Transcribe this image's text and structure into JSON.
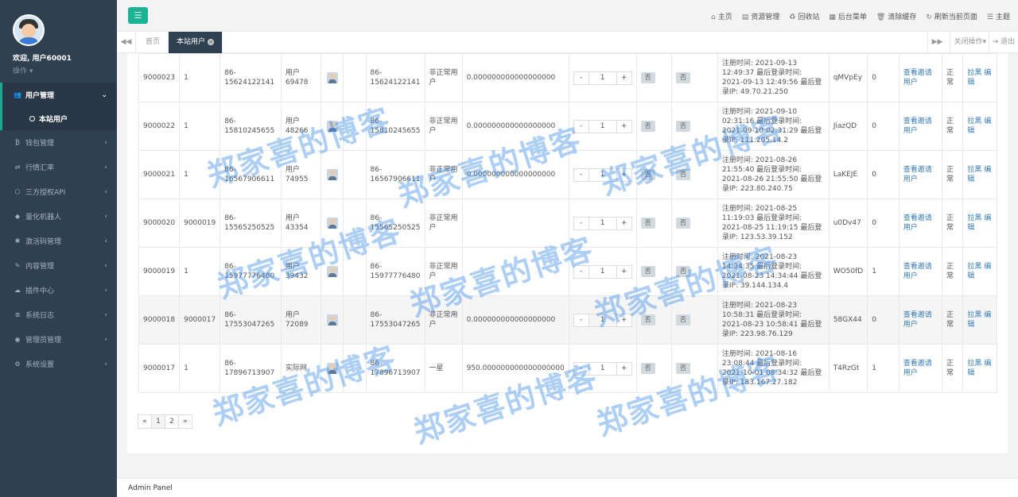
{
  "sidebar": {
    "welcome": "欢迎, 用户60001",
    "ops": "操作",
    "menu": [
      {
        "label": "用户管理",
        "icon": "users-icon",
        "glyph": "👥",
        "active": true
      },
      {
        "label": "钱包管理",
        "icon": "bitcoin-icon",
        "glyph": "₿"
      },
      {
        "label": "行情汇率",
        "icon": "exchange-icon",
        "glyph": "⇄"
      },
      {
        "label": "三方授权API",
        "icon": "cube-icon",
        "glyph": "⬡"
      },
      {
        "label": "量化机器人",
        "icon": "robot-icon",
        "glyph": "◆"
      },
      {
        "label": "激活码管理",
        "icon": "gear-icon",
        "glyph": "✱"
      },
      {
        "label": "内容管理",
        "icon": "edit-icon",
        "glyph": "✎"
      },
      {
        "label": "插件中心",
        "icon": "cloud-icon",
        "glyph": "☁"
      },
      {
        "label": "系统日志",
        "icon": "database-icon",
        "glyph": "≣"
      },
      {
        "label": "管理员管理",
        "icon": "user-circle-icon",
        "glyph": "◉"
      },
      {
        "label": "系统设置",
        "icon": "cogs-icon",
        "glyph": "⚙"
      }
    ],
    "submenu_active": "本站用户"
  },
  "topbar": {
    "links": [
      {
        "label": "主页",
        "glyph": "⌂"
      },
      {
        "label": "资源管理",
        "glyph": "▤"
      },
      {
        "label": "回收站",
        "glyph": "♻"
      },
      {
        "label": "后台菜单",
        "glyph": "▦"
      },
      {
        "label": "清除缓存",
        "glyph": "🗑"
      },
      {
        "label": "刷新当前页面",
        "glyph": "↻"
      },
      {
        "label": "主题",
        "glyph": "☰"
      }
    ]
  },
  "tabs": {
    "home": "首页",
    "current": "本站用户",
    "close_ops": "关闭操作",
    "logout": "退出"
  },
  "table": {
    "rows": [
      {
        "id": "9000023",
        "parent": "1",
        "phone": "86-15624122141",
        "name": "用户69478",
        "phone2": "86-15624122141",
        "type": "非正常用户",
        "balance": "0.000000000000000000",
        "qty": "1",
        "f1": "否",
        "f2": "否",
        "reg": "注册时间: 2021-09-13 12:49:37 最后登录时间: 2021-09-13 12:49:56 最后登录IP: 49.70.21.250",
        "code": "qMVpEy",
        "count": "0",
        "invite": "查看邀请用户",
        "status": "正常",
        "actions": "拉黑 编辑"
      },
      {
        "id": "9000022",
        "parent": "1",
        "phone": "86-15810245655",
        "name": "用户48266",
        "phone2": "86-15810245655",
        "type": "非正常用户",
        "balance": "0.000000000000000000",
        "qty": "1",
        "f1": "否",
        "f2": "否",
        "reg": "注册时间: 2021-09-10 02:31:16 最后登录时间: 2021-09-10 02:31:29 最后登录IP: 111.205.14.2",
        "code": "JiazQD",
        "count": "0",
        "invite": "查看邀请用户",
        "status": "正常",
        "actions": "拉黑 编辑"
      },
      {
        "id": "9000021",
        "parent": "1",
        "phone": "86-16567906611",
        "name": "用户74955",
        "phone2": "86-16567906611",
        "type": "非正常用户",
        "balance": "0.000000000000000000",
        "qty": "1",
        "f1": "否",
        "f2": "否",
        "reg": "注册时间: 2021-08-26 21:55:40 最后登录时间: 2021-08-26 21:55:50 最后登录IP: 223.80.240.75",
        "code": "LaKEJE",
        "count": "0",
        "invite": "查看邀请用户",
        "status": "正常",
        "actions": "拉黑 编辑"
      },
      {
        "id": "9000020",
        "parent": "9000019",
        "phone": "86-15565250525",
        "name": "用户43354",
        "phone2": "86-15565250525",
        "type": "非正常用户",
        "balance": "",
        "qty": "1",
        "f1": "否",
        "f2": "否",
        "reg": "注册时间: 2021-08-25 11:19:03 最后登录时间: 2021-08-25 11:19:15 最后登录IP: 123.53.39.152",
        "code": "u0Dv47",
        "count": "0",
        "invite": "查看邀请用户",
        "status": "正常",
        "actions": "拉黑 编辑"
      },
      {
        "id": "9000019",
        "parent": "1",
        "phone": "86-15977776480",
        "name": "用户39432",
        "phone2": "86-15977776480",
        "type": "非正常用户",
        "balance": "",
        "qty": "1",
        "f1": "否",
        "f2": "否",
        "reg": "注册时间: 2021-08-23 14:34:35 最后登录时间: 2021-08-23 14:34:44 最后登录IP: 39.144.134.4",
        "code": "WO50fD",
        "count": "1",
        "invite": "查看邀请用户",
        "status": "正常",
        "actions": "拉黑 编辑"
      },
      {
        "id": "9000018",
        "parent": "9000017",
        "phone": "86-17553047265",
        "name": "用户72089",
        "phone2": "86-17553047265",
        "type": "非正常用户",
        "balance": "0.000000000000000000",
        "qty": "1",
        "f1": "否",
        "f2": "否",
        "reg": "注册时间: 2021-08-23 10:58:31 最后登录时间: 2021-08-23 10:58:41 最后登录IP: 223.98.76.129",
        "code": "58GX44",
        "count": "0",
        "invite": "查看邀请用户",
        "status": "正常",
        "actions": "拉黑 编辑"
      },
      {
        "id": "9000017",
        "parent": "1",
        "phone": "86-17896713907",
        "name": "实际网",
        "phone2": "86-17896713907",
        "type": "一星",
        "balance": "950.000000000000000000",
        "qty": "1",
        "f1": "否",
        "f2": "否",
        "reg": "注册时间: 2021-08-16 23:08:44 最后登录时间: 2021-10-01 08:34:32 最后登录IP: 183.167.27.182",
        "code": "T4RzGt",
        "count": "1",
        "invite": "查看邀请用户",
        "status": "正常",
        "actions": "拉黑 编辑"
      }
    ]
  },
  "pagination": [
    "«",
    "1",
    "2",
    "»"
  ],
  "footer": "Admin Panel",
  "watermark": "郑家喜的博客"
}
